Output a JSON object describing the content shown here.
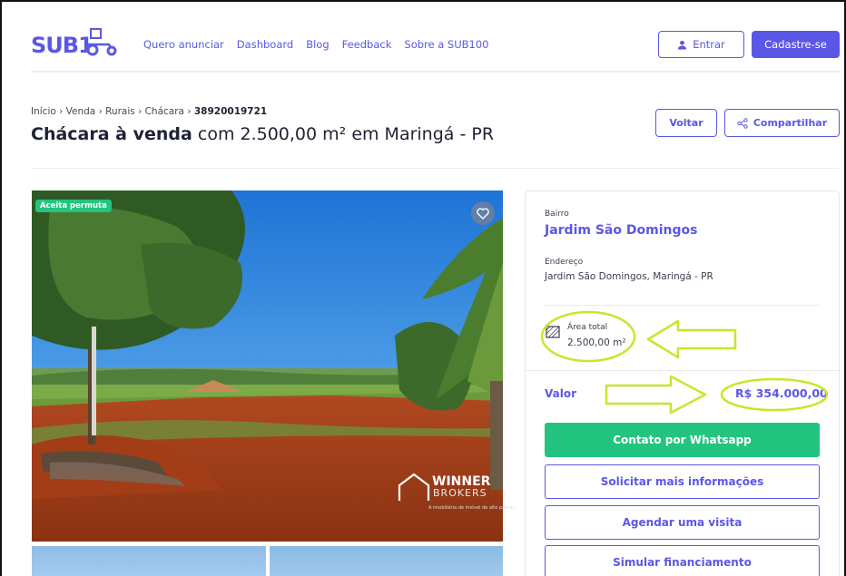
{
  "header": {
    "logo": "SUB100",
    "nav": [
      "Quero anunciar",
      "Dashboard",
      "Blog",
      "Feedback",
      "Sobre a SUB100"
    ],
    "login_label": "Entrar",
    "signup_label": "Cadastre-se"
  },
  "breadcrumb": {
    "path": "Início › Venda › Rurais › Chácara › ",
    "code": "38920019721"
  },
  "title": {
    "bold": "Chácara à venda",
    "rest": " com 2.500,00 m² em Maringá - PR"
  },
  "actions": {
    "back": "Voltar",
    "share": "Compartilhar"
  },
  "photo": {
    "badge": "Aceita permuta",
    "watermark_main": "WINNER",
    "watermark_sub": "BROKERS",
    "watermark_tiny": "A imobiliária de imóvel de alto padrão"
  },
  "details": {
    "bairro_label": "Bairro",
    "bairro": "Jardim São Domingos",
    "endereco_label": "Endereço",
    "endereco": "Jardim São Domingos, Maringá - PR",
    "area_label": "Área total",
    "area": "2.500,00 m²",
    "valor_label": "Valor",
    "valor": "R$ 354.000,00"
  },
  "buttons": {
    "whatsapp": "Contato por Whatsapp",
    "info": "Solicitar mais informações",
    "visit": "Agendar uma visita",
    "finance": "Simular financiamento"
  },
  "colors": {
    "brand": "#5b57e6",
    "green": "#23c47f",
    "highlight": "#c8e62a"
  }
}
